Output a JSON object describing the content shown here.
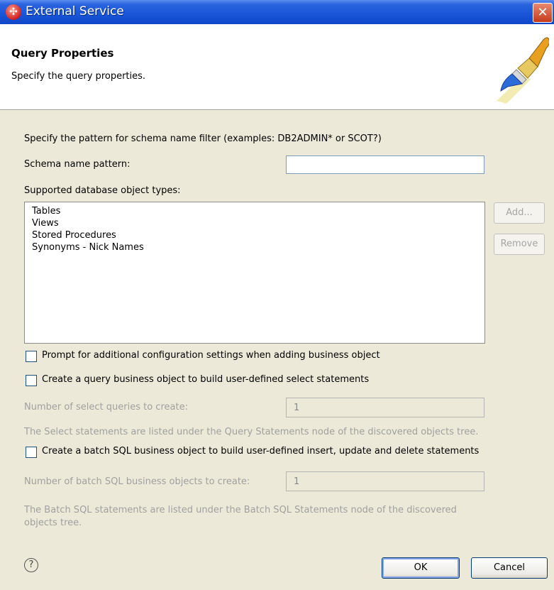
{
  "window": {
    "title": "External Service"
  },
  "header": {
    "title": "Query Properties",
    "description": "Specify the query properties."
  },
  "schema": {
    "instruction": "Specify the pattern for schema name filter (examples: DB2ADMIN* or SCOT?)",
    "label": "Schema name pattern:",
    "value": ""
  },
  "object_types": {
    "label": "Supported database object types:",
    "items": [
      "Tables",
      "Views",
      "Stored Procedures",
      "Synonyms - Nick Names"
    ],
    "add_label": "Add...",
    "remove_label": "Remove"
  },
  "options": {
    "prompt_label": "Prompt for additional configuration settings when adding business object",
    "query_label": "Create a query business object to build user-defined select statements",
    "select_count_label": "Number of select queries to create:",
    "select_count_value": "1",
    "select_note": "The Select statements are listed under the Query Statements node of the discovered objects tree.",
    "batch_label": "Create a batch SQL business object to build user-defined insert, update and delete statements",
    "batch_count_label": "Number of batch SQL business objects to create:",
    "batch_count_value": "1",
    "batch_note_line1": "The Batch SQL statements are listed under the Batch SQL Statements node of the discovered",
    "batch_note_line2": "objects tree."
  },
  "footer": {
    "help_icon": "?",
    "ok_label": "OK",
    "cancel_label": "Cancel"
  },
  "icons": {
    "app": "wizard-app-icon",
    "close": "close-icon",
    "help": "help-icon",
    "banner": "brush-icon"
  },
  "colors": {
    "titlebar": "#1855d8",
    "window": "#ece9d8",
    "close": "#c5391a"
  }
}
